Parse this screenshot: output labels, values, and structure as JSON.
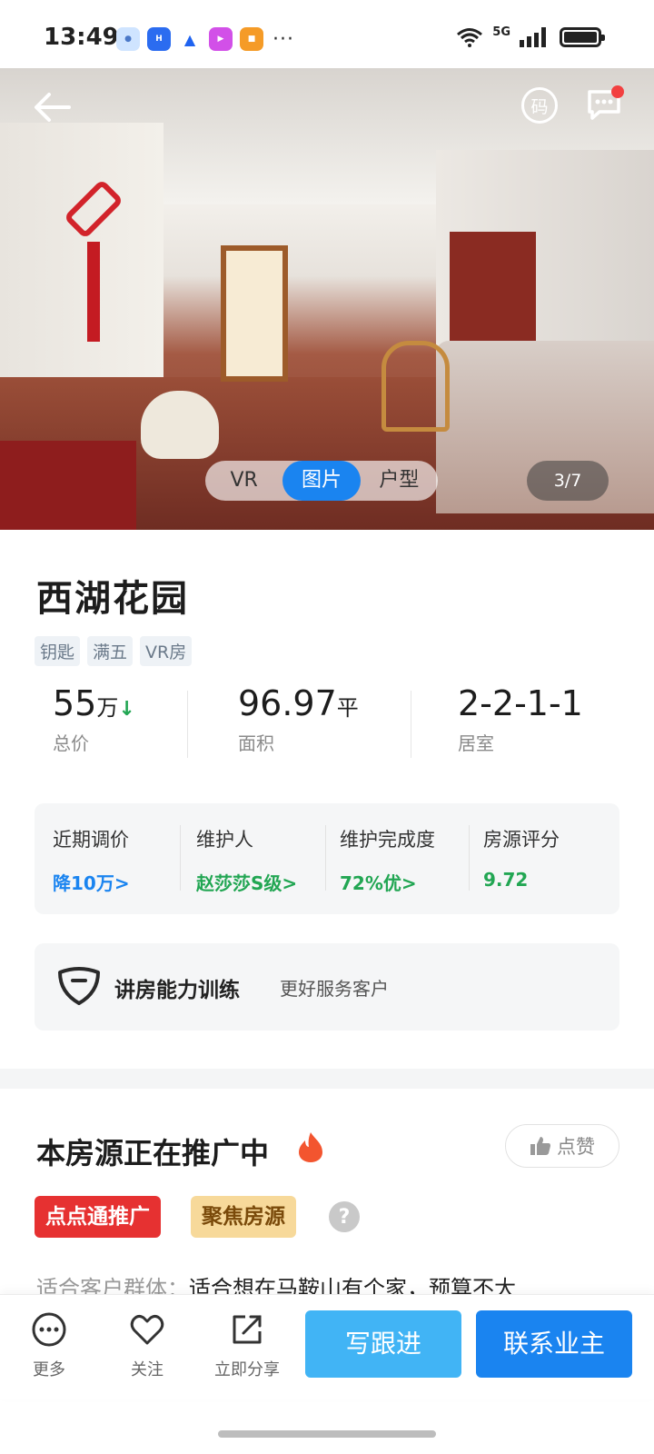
{
  "status_bar": {
    "time": "13:49",
    "network": "5G",
    "app_icons": [
      "ai-assistant-icon",
      "honor-icon",
      "maps-icon",
      "video-icon",
      "store-icon"
    ],
    "overflow": "···"
  },
  "header": {
    "code_label": "码"
  },
  "gallery": {
    "tabs": [
      "VR",
      "图片",
      "户型"
    ],
    "active_tab": "图片",
    "pager": "3/7"
  },
  "listing": {
    "title": "西湖花园",
    "tags": [
      "钥匙",
      "满五",
      "VR房"
    ],
    "price": {
      "value": "55",
      "unit": "万",
      "trend": "down",
      "label": "总价"
    },
    "area": {
      "value": "96.97",
      "unit": "平",
      "label": "面积"
    },
    "rooms": {
      "value": "2-2-1-1",
      "label": "居室"
    }
  },
  "info": {
    "recent_price": {
      "label": "近期调价",
      "value": "降10万>"
    },
    "maintainer": {
      "label": "维护人",
      "value": "赵莎莎S级>"
    },
    "maintenance": {
      "label": "维护完成度",
      "value": "72%优>"
    },
    "score": {
      "label": "房源评分",
      "value": "9.72"
    }
  },
  "training": {
    "title": "讲房能力训练",
    "subtitle": "更好服务客户"
  },
  "promotion": {
    "title": "本房源正在推广中",
    "like_label": "点赞",
    "badge_primary": "点点通推广",
    "badge_secondary": "聚焦房源",
    "help": "?",
    "suitable_label": "适合客户群体：",
    "suitable_text": "适合想在马鞍山有个家，预算不大"
  },
  "bottom_bar": {
    "more": "更多",
    "follow": "关注",
    "share": "立即分享",
    "write_followup": "写跟进",
    "contact_owner": "联系业主"
  },
  "colors": {
    "primary_blue": "#1a84f0",
    "light_blue": "#41b4f5",
    "green": "#22a653",
    "red": "#e63131",
    "gold": "#f7d99a"
  }
}
